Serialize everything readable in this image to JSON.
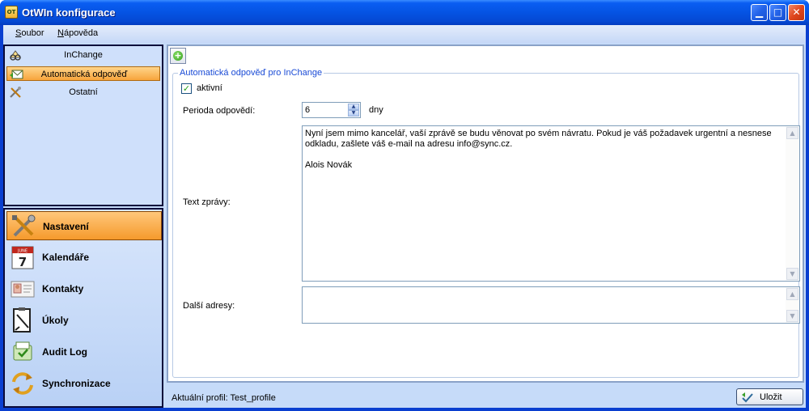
{
  "window": {
    "title": "OtWIn konfigurace",
    "app_icon": "app-icon",
    "minimize": "▁",
    "maximize": "□",
    "close": "✕"
  },
  "menu": [
    {
      "label": "Soubor",
      "underline": "S",
      "rest": "oubor"
    },
    {
      "label": "Nápověda",
      "underline": "N",
      "rest": "ápověda"
    }
  ],
  "tree": {
    "items": [
      {
        "label": "InChange",
        "icon": "inchange-icon"
      },
      {
        "label": "Automatická odpověď",
        "icon": "auto-reply-icon",
        "selected": true
      },
      {
        "label": "Ostatní",
        "icon": "tools-icon"
      }
    ]
  },
  "nav": {
    "items": [
      {
        "label": "Nastavení",
        "icon": "tools-icon",
        "selected": true
      },
      {
        "label": "Kalendáře",
        "icon": "calendar-icon",
        "calendar_day": "7",
        "calendar_month": "JUNE"
      },
      {
        "label": "Kontakty",
        "icon": "contact-card-icon"
      },
      {
        "label": "Úkoly",
        "icon": "task-icon"
      },
      {
        "label": "Audit Log",
        "icon": "audit-log-icon"
      },
      {
        "label": "Synchronizace",
        "icon": "sync-icon"
      }
    ]
  },
  "toolbar": {
    "add_icon": "add-icon",
    "add_glyph": "+"
  },
  "group": {
    "legend": "Automatická odpověď pro InChange",
    "active_checked": true,
    "active_glyph": "✓",
    "active_label": "aktivní",
    "period_label": "Perioda odpovědí:",
    "period_value": "6",
    "period_unit": "dny",
    "text_label": "Text zprávy:",
    "text_value": "Nyní jsem mimo kancelář, vaší zprávě se budu věnovat po svém návratu. Pokud je váš požadavek urgentní a nesnese odkladu, zašlete váš e-mail na adresu info@sync.cz.\n\nAlois Novák",
    "other_label": "Další adresy:",
    "other_value": ""
  },
  "status": {
    "profile_text": "Aktuální profil: Test_profile",
    "save_label": "Uložit",
    "save_icon": "save-icon"
  },
  "colors": {
    "titlebar": "#0553e3",
    "selected_item": "#f7a43c",
    "legend_text": "#1a4bd6",
    "panel_bg": "#c6dbf9"
  }
}
